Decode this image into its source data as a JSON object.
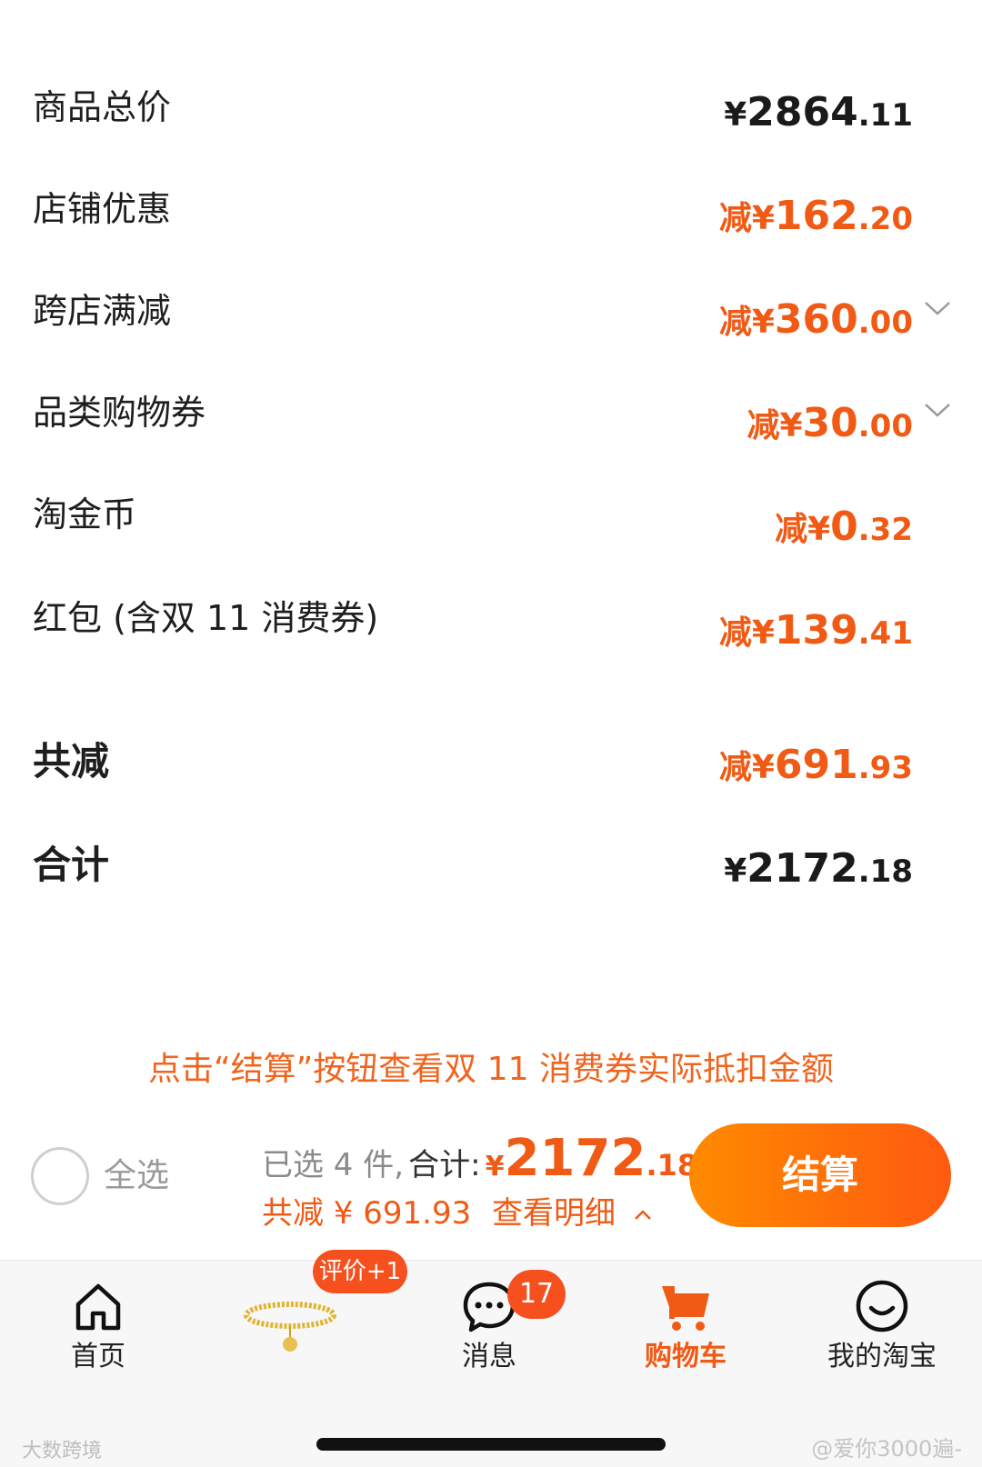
{
  "rows": [
    {
      "label": "商品总价",
      "prefix": "",
      "yen": "¥",
      "int": "2864",
      "dec": ".11",
      "color": "black",
      "chevron": false
    },
    {
      "label": "店铺优惠",
      "prefix": "减",
      "yen": "¥",
      "int": "162",
      "dec": ".20",
      "color": "orange",
      "chevron": false
    },
    {
      "label": "跨店满减",
      "prefix": "减",
      "yen": "¥",
      "int": "360",
      "dec": ".00",
      "color": "orange",
      "chevron": true
    },
    {
      "label": "品类购物券",
      "prefix": "减",
      "yen": "¥",
      "int": "30",
      "dec": ".00",
      "color": "orange",
      "chevron": true
    },
    {
      "label": "淘金币",
      "prefix": "减",
      "yen": "¥",
      "int": "0",
      "dec": ".32",
      "color": "orange",
      "chevron": false
    },
    {
      "label": "红包 (含双 11 消费券)",
      "prefix": "减",
      "yen": "¥",
      "int": "139",
      "dec": ".41",
      "color": "orange",
      "chevron": false
    },
    {
      "label": "共减",
      "prefix": "减",
      "yen": "¥",
      "int": "691",
      "dec": ".93",
      "color": "orange",
      "chevron": false
    },
    {
      "label": "合计",
      "prefix": "",
      "yen": "¥",
      "int": "2172",
      "dec": ".18",
      "color": "black",
      "chevron": false
    }
  ],
  "tip": "点击“结算”按钮查看双 11 消费券实际抵扣金额",
  "checkout": {
    "select_all_label": "全选",
    "selected_text": "已选 4 件,",
    "total_label": "合计:",
    "total_yen": "¥",
    "total_int": "2172",
    "total_dec": ".18",
    "discount_text": "共减 ¥ 691.93",
    "details_label": "查看明细",
    "button_label": "结算"
  },
  "tabs": {
    "home": {
      "label": "首页",
      "icon": "home-icon"
    },
    "review": {
      "badge": "评价+1",
      "icon": "bracelet-thumbnail"
    },
    "messages": {
      "label": "消息",
      "badge": "17",
      "icon": "chat-bubble-icon"
    },
    "cart": {
      "label": "购物车",
      "icon": "cart-icon",
      "active": true
    },
    "mine": {
      "label": "我的淘宝",
      "icon": "smile-icon"
    }
  },
  "watermarks": {
    "left": "大数跨境",
    "right": "@爱你3000遍-"
  },
  "colors": {
    "accent": "#f05a14",
    "button_start": "#ff8a00",
    "button_end": "#ff5a10"
  }
}
